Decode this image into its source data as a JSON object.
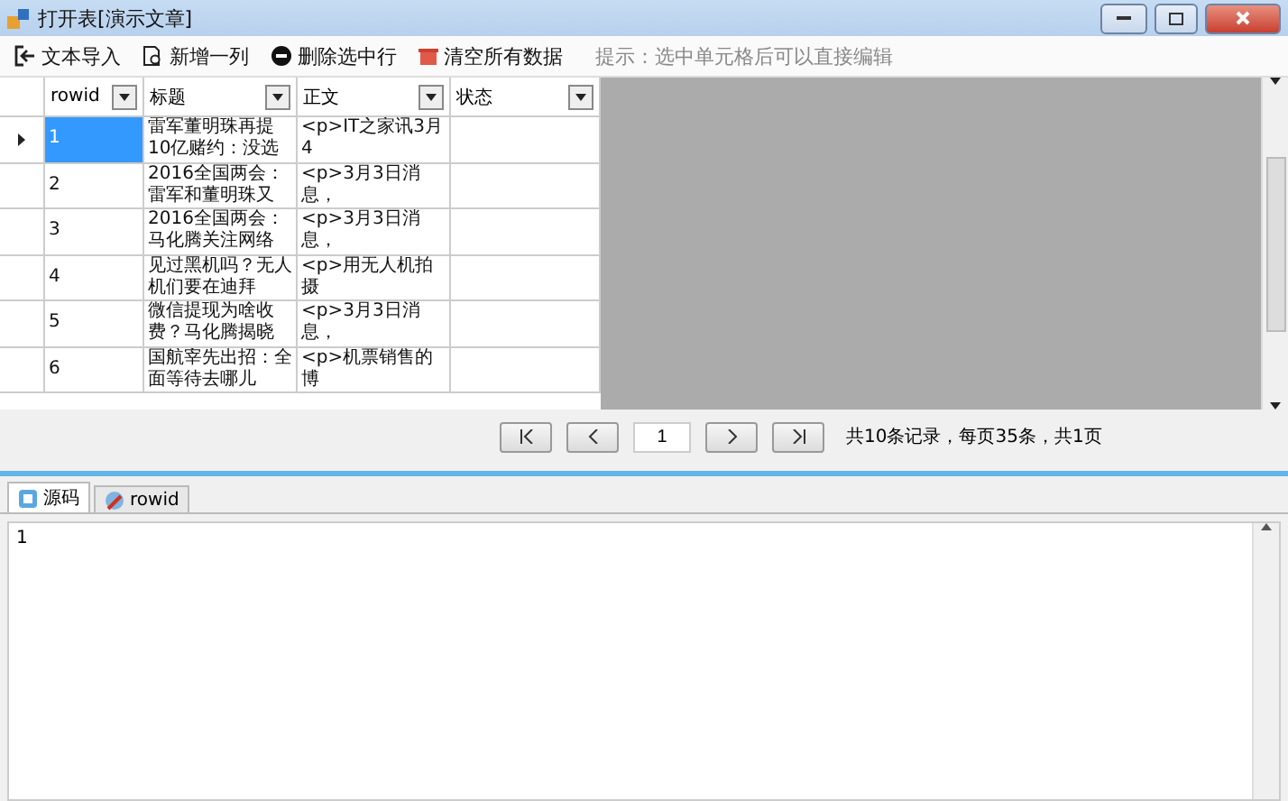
{
  "window": {
    "title": "打开表[演示文章]"
  },
  "toolbar": {
    "buttons": [
      {
        "kind": "import",
        "label": "文本导入"
      },
      {
        "kind": "add",
        "label": "新增一列"
      },
      {
        "kind": "delete",
        "label": "删除选中行"
      },
      {
        "kind": "clear",
        "label": "清空所有数据"
      }
    ],
    "hint": "提示：选中单元格后可以直接编辑"
  },
  "table": {
    "columns": [
      "rowid",
      "标题",
      "正文",
      "状态"
    ],
    "rows": [
      {
        "rowid": "1",
        "title": "雷军董明珠再提10亿赌约：没选",
        "body": "<p>IT之家讯3月4",
        "status": "",
        "selected": true
      },
      {
        "rowid": "2",
        "title": "2016全国两会：雷军和董明珠又",
        "body": "<p>3月3日消息，",
        "status": "",
        "selected": false
      },
      {
        "rowid": "3",
        "title": "2016全国两会：马化腾关注网络",
        "body": "<p>3月3日消息，",
        "status": "",
        "selected": false
      },
      {
        "rowid": "4",
        "title": "见过黑机吗？无人机们要在迪拜",
        "body": "<p>用无人机拍摄",
        "status": "",
        "selected": false
      },
      {
        "rowid": "5",
        "title": "微信提现为啥收费？马化腾揭晓",
        "body": "<p>3月3日消息，",
        "status": "",
        "selected": false
      },
      {
        "rowid": "6",
        "title": "国航宰先出招：全面等待去哪儿",
        "body": "<p>机票销售的博",
        "status": "",
        "selected": false
      }
    ]
  },
  "pager": {
    "page": "1",
    "summary": "共10条记录，每页35条，共1页"
  },
  "tabs": [
    {
      "kind": "source",
      "label": "源码",
      "selected": true
    },
    {
      "kind": "rowid",
      "label": "rowid",
      "selected": false
    }
  ],
  "editor": {
    "value": "1"
  }
}
